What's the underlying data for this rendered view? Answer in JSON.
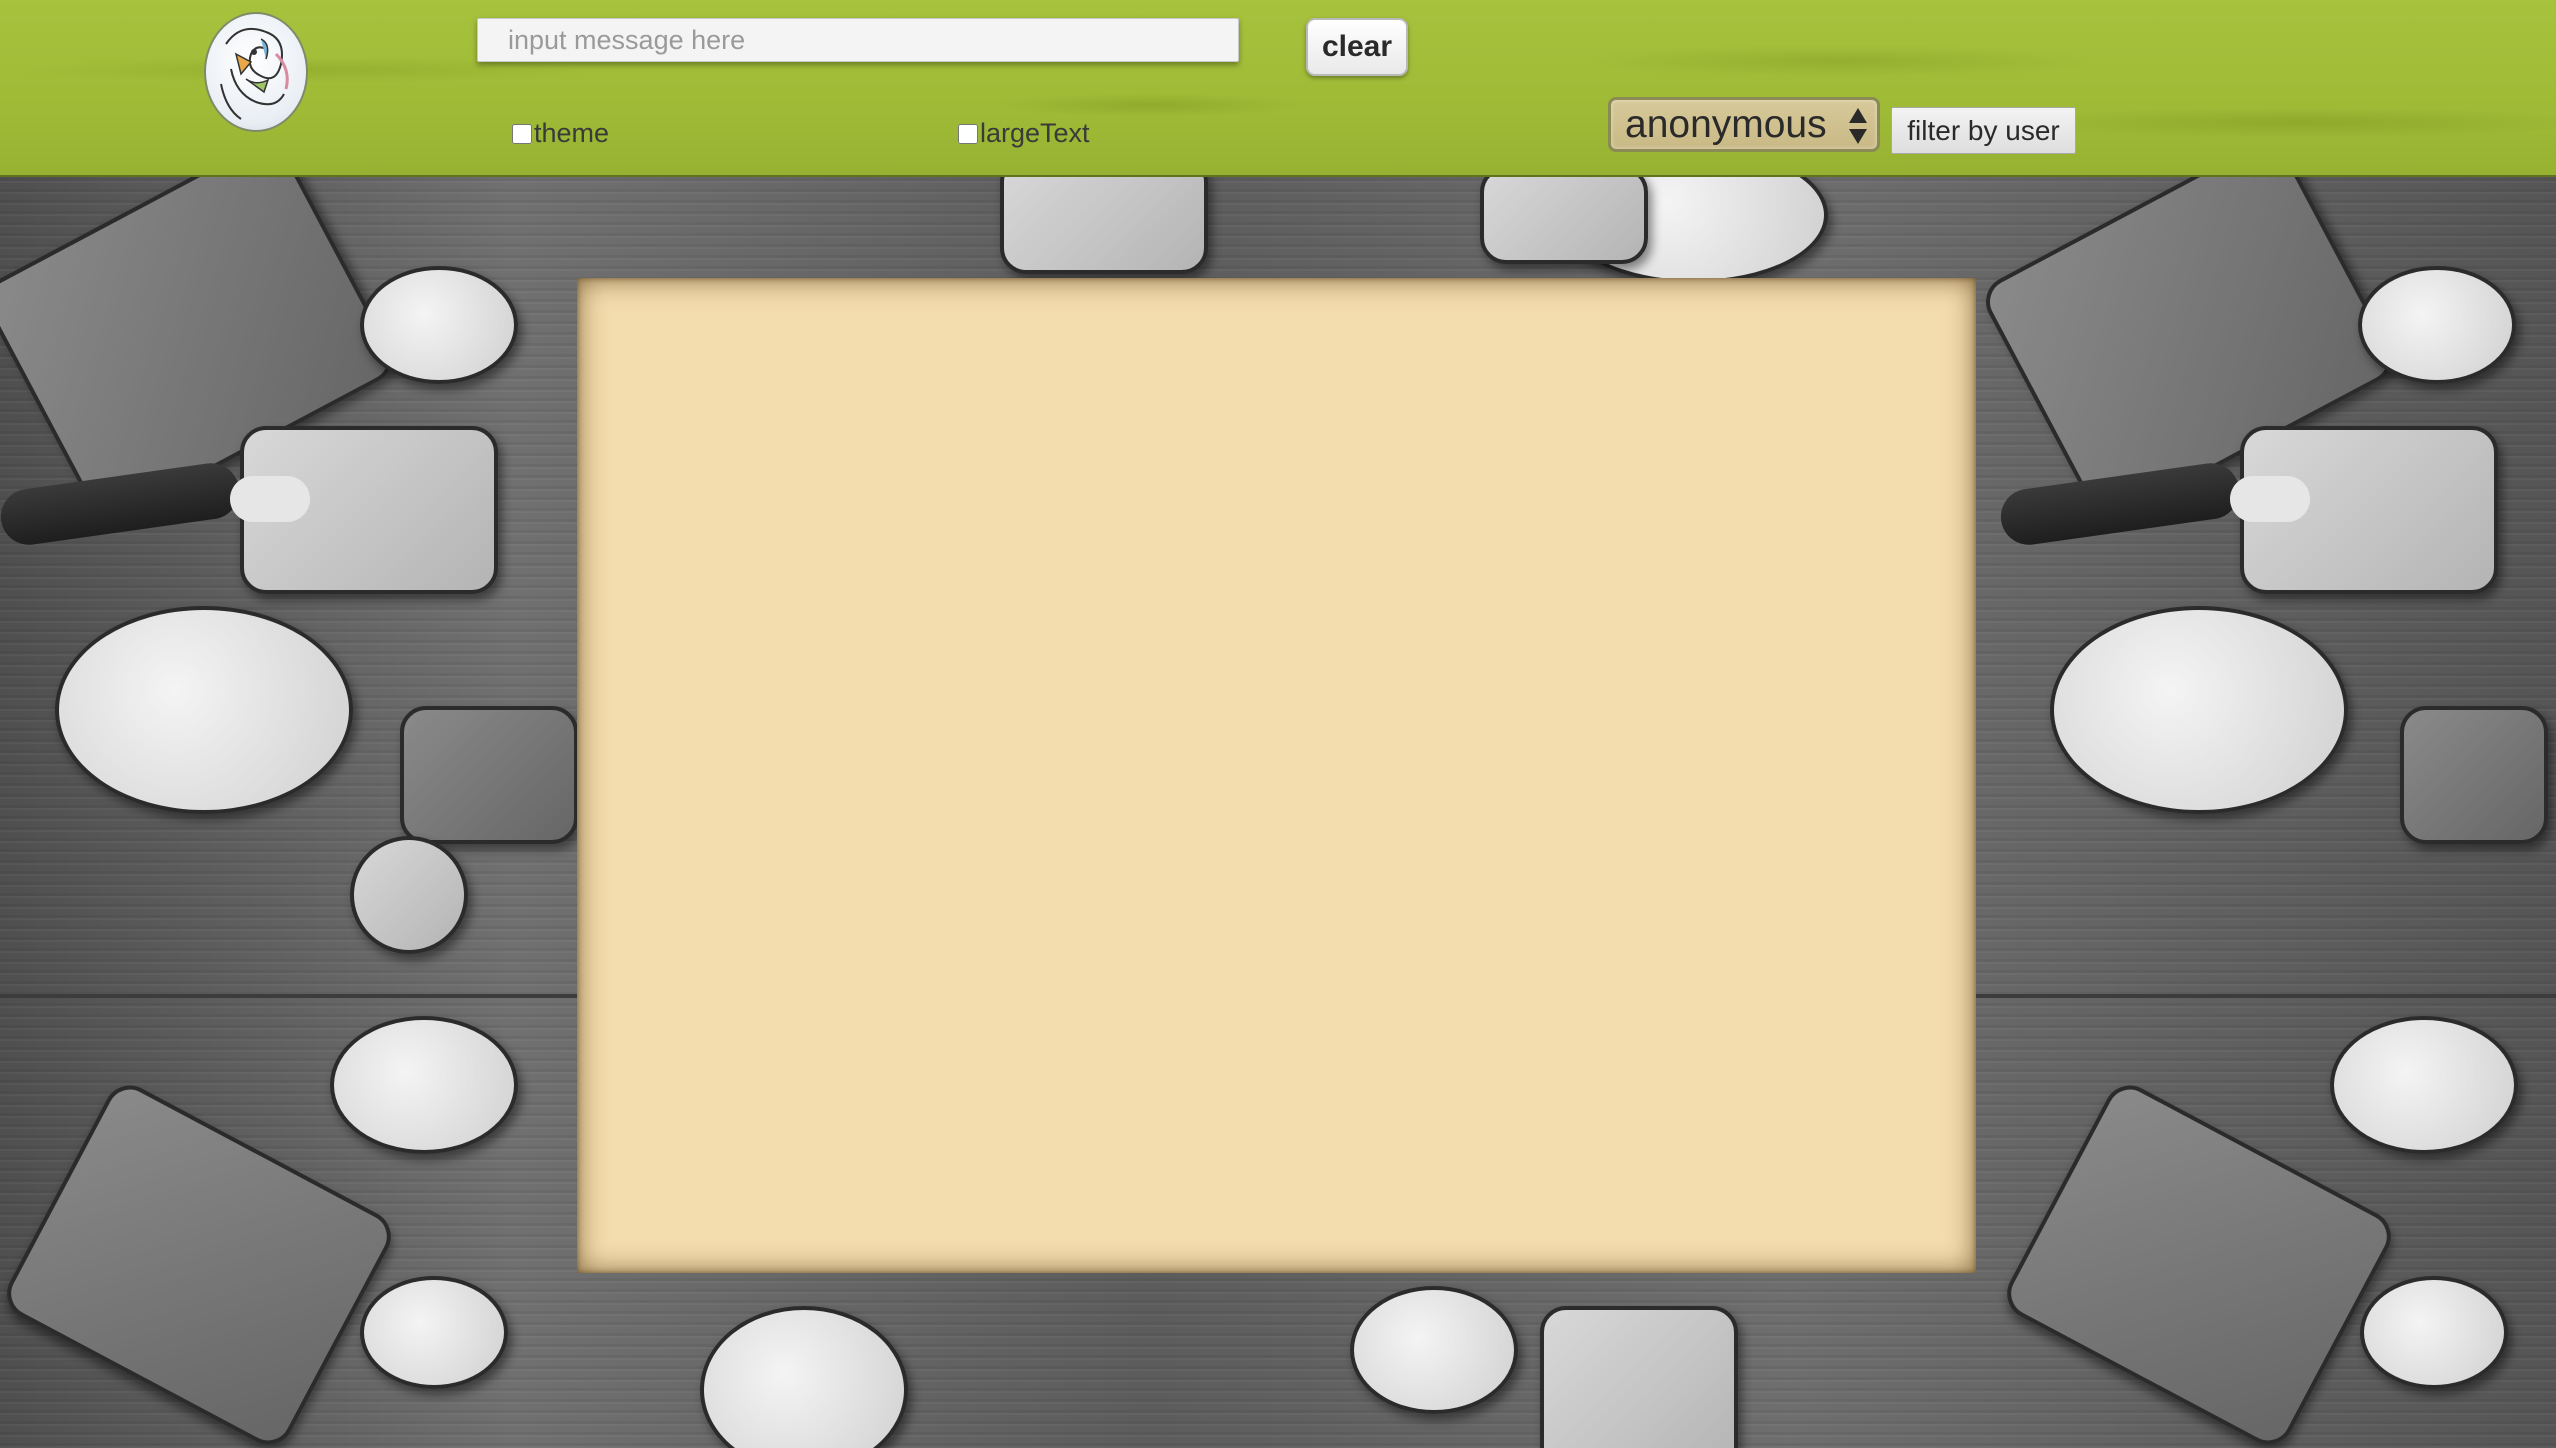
{
  "header": {
    "logo_icon": "abstract-face-logo-icon",
    "message_input": {
      "placeholder": "input message here",
      "value": ""
    },
    "clear_label": "clear",
    "theme_label": "theme",
    "theme_checked": false,
    "large_text_label": "largeText",
    "large_text_checked": false,
    "user_select": {
      "selected": "anonymous",
      "arrow_icon": "select-updown-arrows-icon"
    },
    "filter_label": "filter by user"
  },
  "colors": {
    "header_green": "#a7c23d",
    "panel_beige": "#f3dcad",
    "select_tan": "#d7c99a"
  },
  "message_panel": {
    "messages": []
  }
}
